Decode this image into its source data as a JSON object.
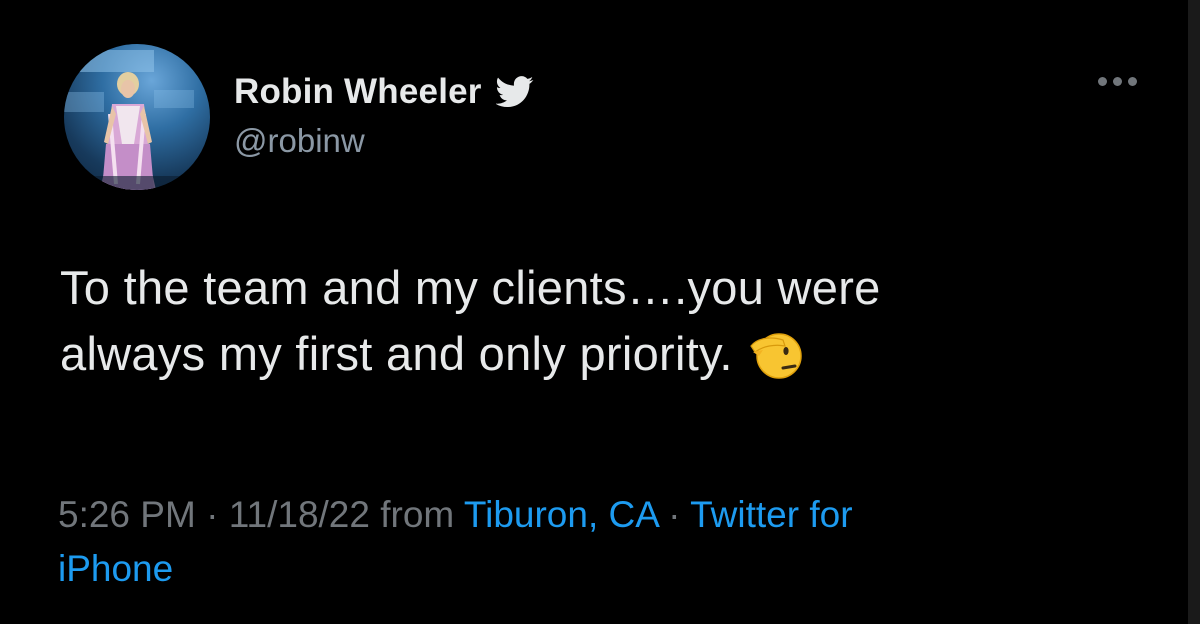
{
  "author": {
    "display_name": "Robin Wheeler",
    "handle": "@robinw",
    "verified_icon": "verified-bird-icon",
    "avatar": "profile-photo"
  },
  "tweet": {
    "text_line_1": "To the team and my clients….you were",
    "text_line_2": "always my first and only priority.",
    "emoji": "saluting-face"
  },
  "meta": {
    "time": "5:26 PM",
    "separator_1": " · ",
    "date": "11/18/22",
    "from_word": " from ",
    "location": "Tiburon, CA",
    "separator_2": " · ",
    "source_part_1": "Twitter for",
    "source_part_2": "iPhone"
  },
  "colors": {
    "background": "#000000",
    "text": "#e7e9ea",
    "secondary": "#71767b",
    "link": "#1d9bf0"
  }
}
